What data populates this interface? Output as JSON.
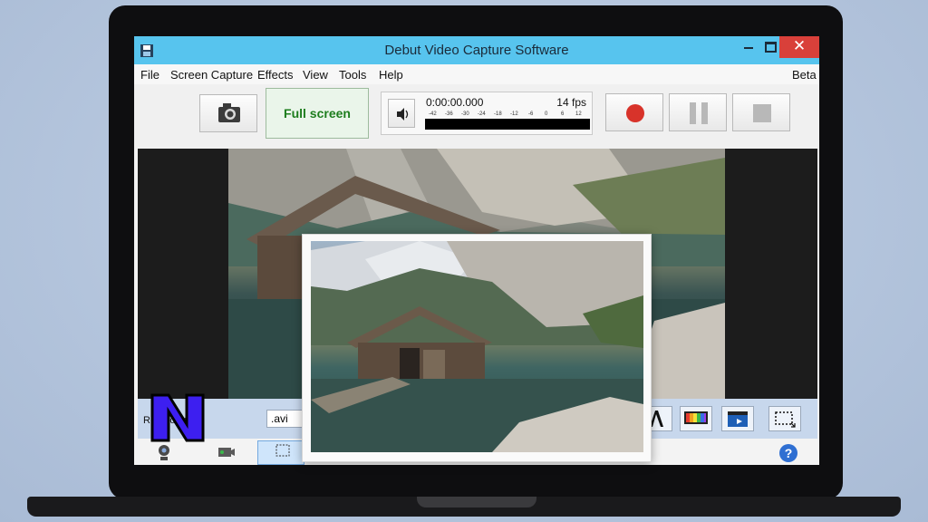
{
  "window": {
    "title": "Debut Video Capture Software",
    "close_glyph": "✕"
  },
  "menu": {
    "items": [
      "File",
      "Screen Capture",
      "Effects",
      "View",
      "Tools",
      "Help"
    ],
    "badge": "Beta"
  },
  "toolbar": {
    "fullscreen_label": "Full screen",
    "time": "0:00:00.000",
    "fps": "14 fps",
    "db_ticks": [
      "-42",
      "-36",
      "-30",
      "-24",
      "-18",
      "-12",
      "-6",
      "0",
      "6",
      "12"
    ]
  },
  "options": {
    "record_as_label": "Record as:",
    "format_value": ".avi"
  },
  "help": {
    "glyph": "?"
  },
  "logo": {
    "letter": "N",
    "fill": "#3d1ff0"
  },
  "colors": {
    "titlebar": "#57c4ee",
    "close": "#d9403a",
    "record_dot": "#d8332a",
    "fullscreen_text": "#1d7d1d"
  },
  "icons": {
    "snapshot": "camera-icon",
    "volume": "speaker-icon",
    "record": "record-dot-icon",
    "pause": "pause-icon",
    "stop": "stop-square-icon",
    "help": "help-circle-icon"
  }
}
